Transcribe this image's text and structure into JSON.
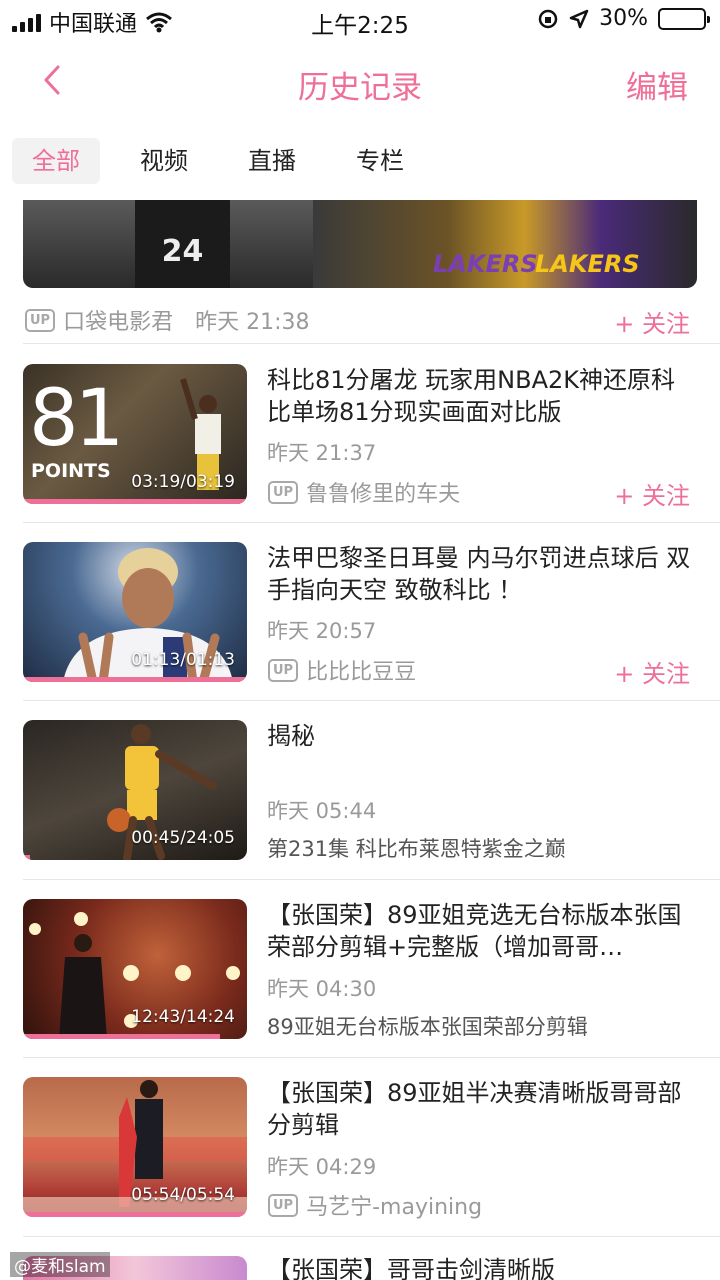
{
  "status_bar": {
    "carrier": "中国联通",
    "time": "上午2:25",
    "battery": "30%",
    "battery_level": 0.3
  },
  "nav": {
    "title": "历史记录",
    "edit": "编辑"
  },
  "tabs": [
    {
      "label": "全部",
      "active": true
    },
    {
      "label": "视频",
      "active": false
    },
    {
      "label": "直播",
      "active": false
    },
    {
      "label": "专栏",
      "active": false
    }
  ],
  "first_item": {
    "jersey": "24",
    "team_text": "LAKERS",
    "up_badge": "UP",
    "uploader": "口袋电影君",
    "time": "昨天  21:38",
    "follow": "+ 关注"
  },
  "items": [
    {
      "title": "科比81分屠龙  玩家用NBA2K神还原科比单场81分现实画面对比版",
      "time": "昨天  21:37",
      "uploader": "鲁鲁修里的车夫",
      "up_badge": "UP",
      "follow": "+ 关注",
      "duration": "03:19/03:19",
      "progress": 1.0,
      "overlay_big": "81",
      "overlay_small": "POINTS"
    },
    {
      "title": "法甲巴黎圣日耳曼  内马尔罚进点球后  双手指向天空  致敬科比  ！",
      "time": "昨天  20:57",
      "uploader": "比比比豆豆",
      "up_badge": "UP",
      "follow": "+ 关注",
      "duration": "01:13/01:13",
      "progress": 1.0
    },
    {
      "title": "揭秘",
      "time": "昨天  05:44",
      "subtitle": "第231集  科比布莱恩特紫金之巅",
      "duration": "00:45/24:05",
      "progress": 0.03
    },
    {
      "title": "【张国荣】89亚姐竞选无台标版本张国荣部分剪辑+完整版（增加哥哥…",
      "time": "昨天  04:30",
      "subtitle": "89亚姐无台标版本张国荣部分剪辑",
      "duration": "12:43/14:24",
      "progress": 0.88
    },
    {
      "title": "【张国荣】89亚姐半决赛清晰版哥哥部分剪辑",
      "time": "昨天  04:29",
      "uploader": "马艺宁-mayining",
      "up_badge": "UP",
      "duration": "05:54/05:54",
      "progress": 1.0
    }
  ],
  "last_item_title": "【张国荣】哥哥击剑清晰版",
  "watermark": "@麦和slam",
  "colors": {
    "accent": "#ee6f97",
    "muted": "#9a9a9a"
  }
}
